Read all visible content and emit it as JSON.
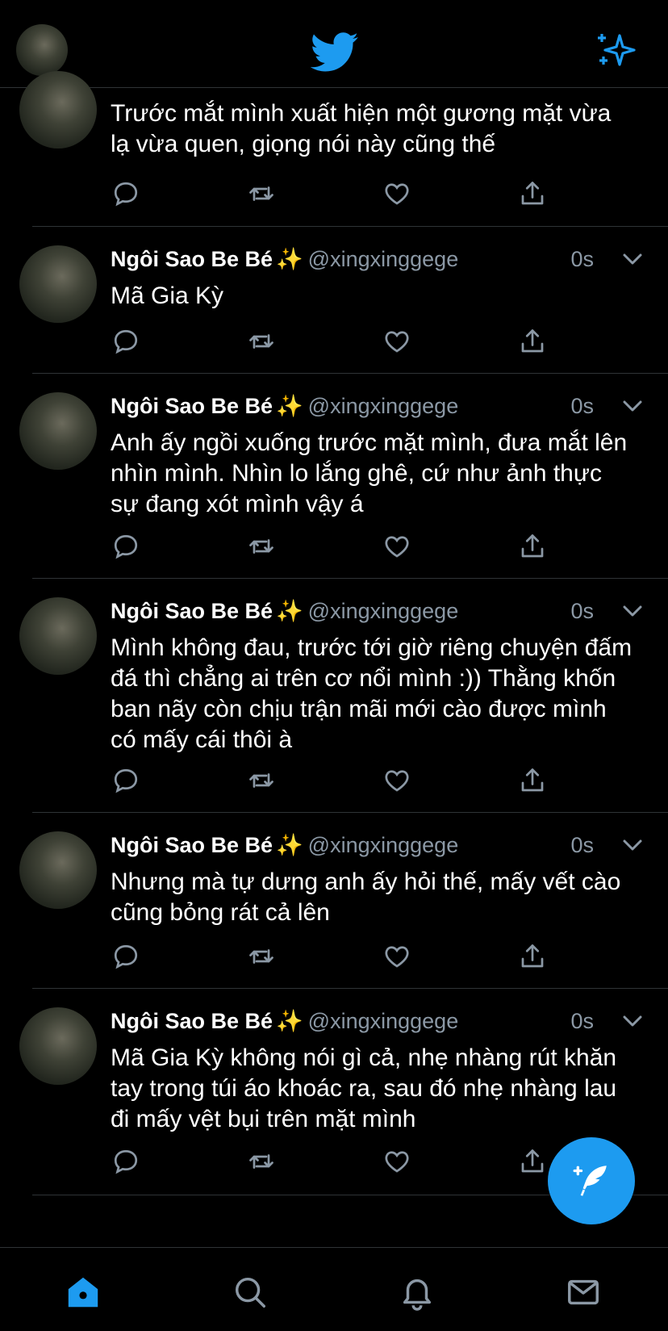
{
  "header": {
    "logo_icon": "twitter-bird-icon",
    "right_icon": "sparkle-icon",
    "accent": "#1d9bf0"
  },
  "tweets": [
    {
      "name": "",
      "handle": "",
      "time": "",
      "text": "Trước mắt mình xuất hiện một gương mặt vừa lạ vừa quen, giọng nói này cũng thế",
      "partial": true
    },
    {
      "name": "Ngôi Sao Be Bé",
      "emoji": "✨",
      "handle": "@xingxinggege",
      "time": "0s",
      "text": "Mã Gia Kỳ"
    },
    {
      "name": "Ngôi Sao Be Bé",
      "emoji": "✨",
      "handle": "@xingxinggege",
      "time": "0s",
      "text": "Anh ấy ngồi xuống trước mặt mình, đưa mắt lên nhìn mình. Nhìn lo lắng ghê, cứ như ảnh thực sự đang xót mình vậy á"
    },
    {
      "name": "Ngôi Sao Be Bé",
      "emoji": "✨",
      "handle": "@xingxinggege",
      "time": "0s",
      "text": "Mình không đau, trước tới giờ riêng chuyện đấm đá thì chẳng ai trên cơ nổi mình :)) Thằng khốn ban nãy còn chịu trận mãi mới cào được mình có mấy cái thôi à"
    },
    {
      "name": "Ngôi Sao Be Bé",
      "emoji": "✨",
      "handle": "@xingxinggege",
      "time": "0s",
      "text": "Nhưng mà tự dưng anh ấy hỏi thế, mấy vết cào cũng bỏng rát cả lên"
    },
    {
      "name": "Ngôi Sao Be Bé",
      "emoji": "✨",
      "handle": "@xingxinggege",
      "time": "0s",
      "text": "Mã Gia Kỳ không nói gì cả, nhẹ nhàng rút khăn tay trong túi áo khoác ra, sau đó nhẹ nhàng lau đi mấy vệt bụi trên mặt mình"
    }
  ],
  "actions": [
    "reply-icon",
    "retweet-icon",
    "like-icon",
    "share-icon"
  ],
  "fab": {
    "icon": "compose-feather-icon"
  },
  "bottom_nav": [
    "home-icon",
    "search-icon",
    "notifications-icon",
    "messages-icon"
  ],
  "colors": {
    "background": "#000000",
    "muted": "#8b98a5",
    "divider": "#2f3336",
    "accent": "#1d9bf0"
  }
}
